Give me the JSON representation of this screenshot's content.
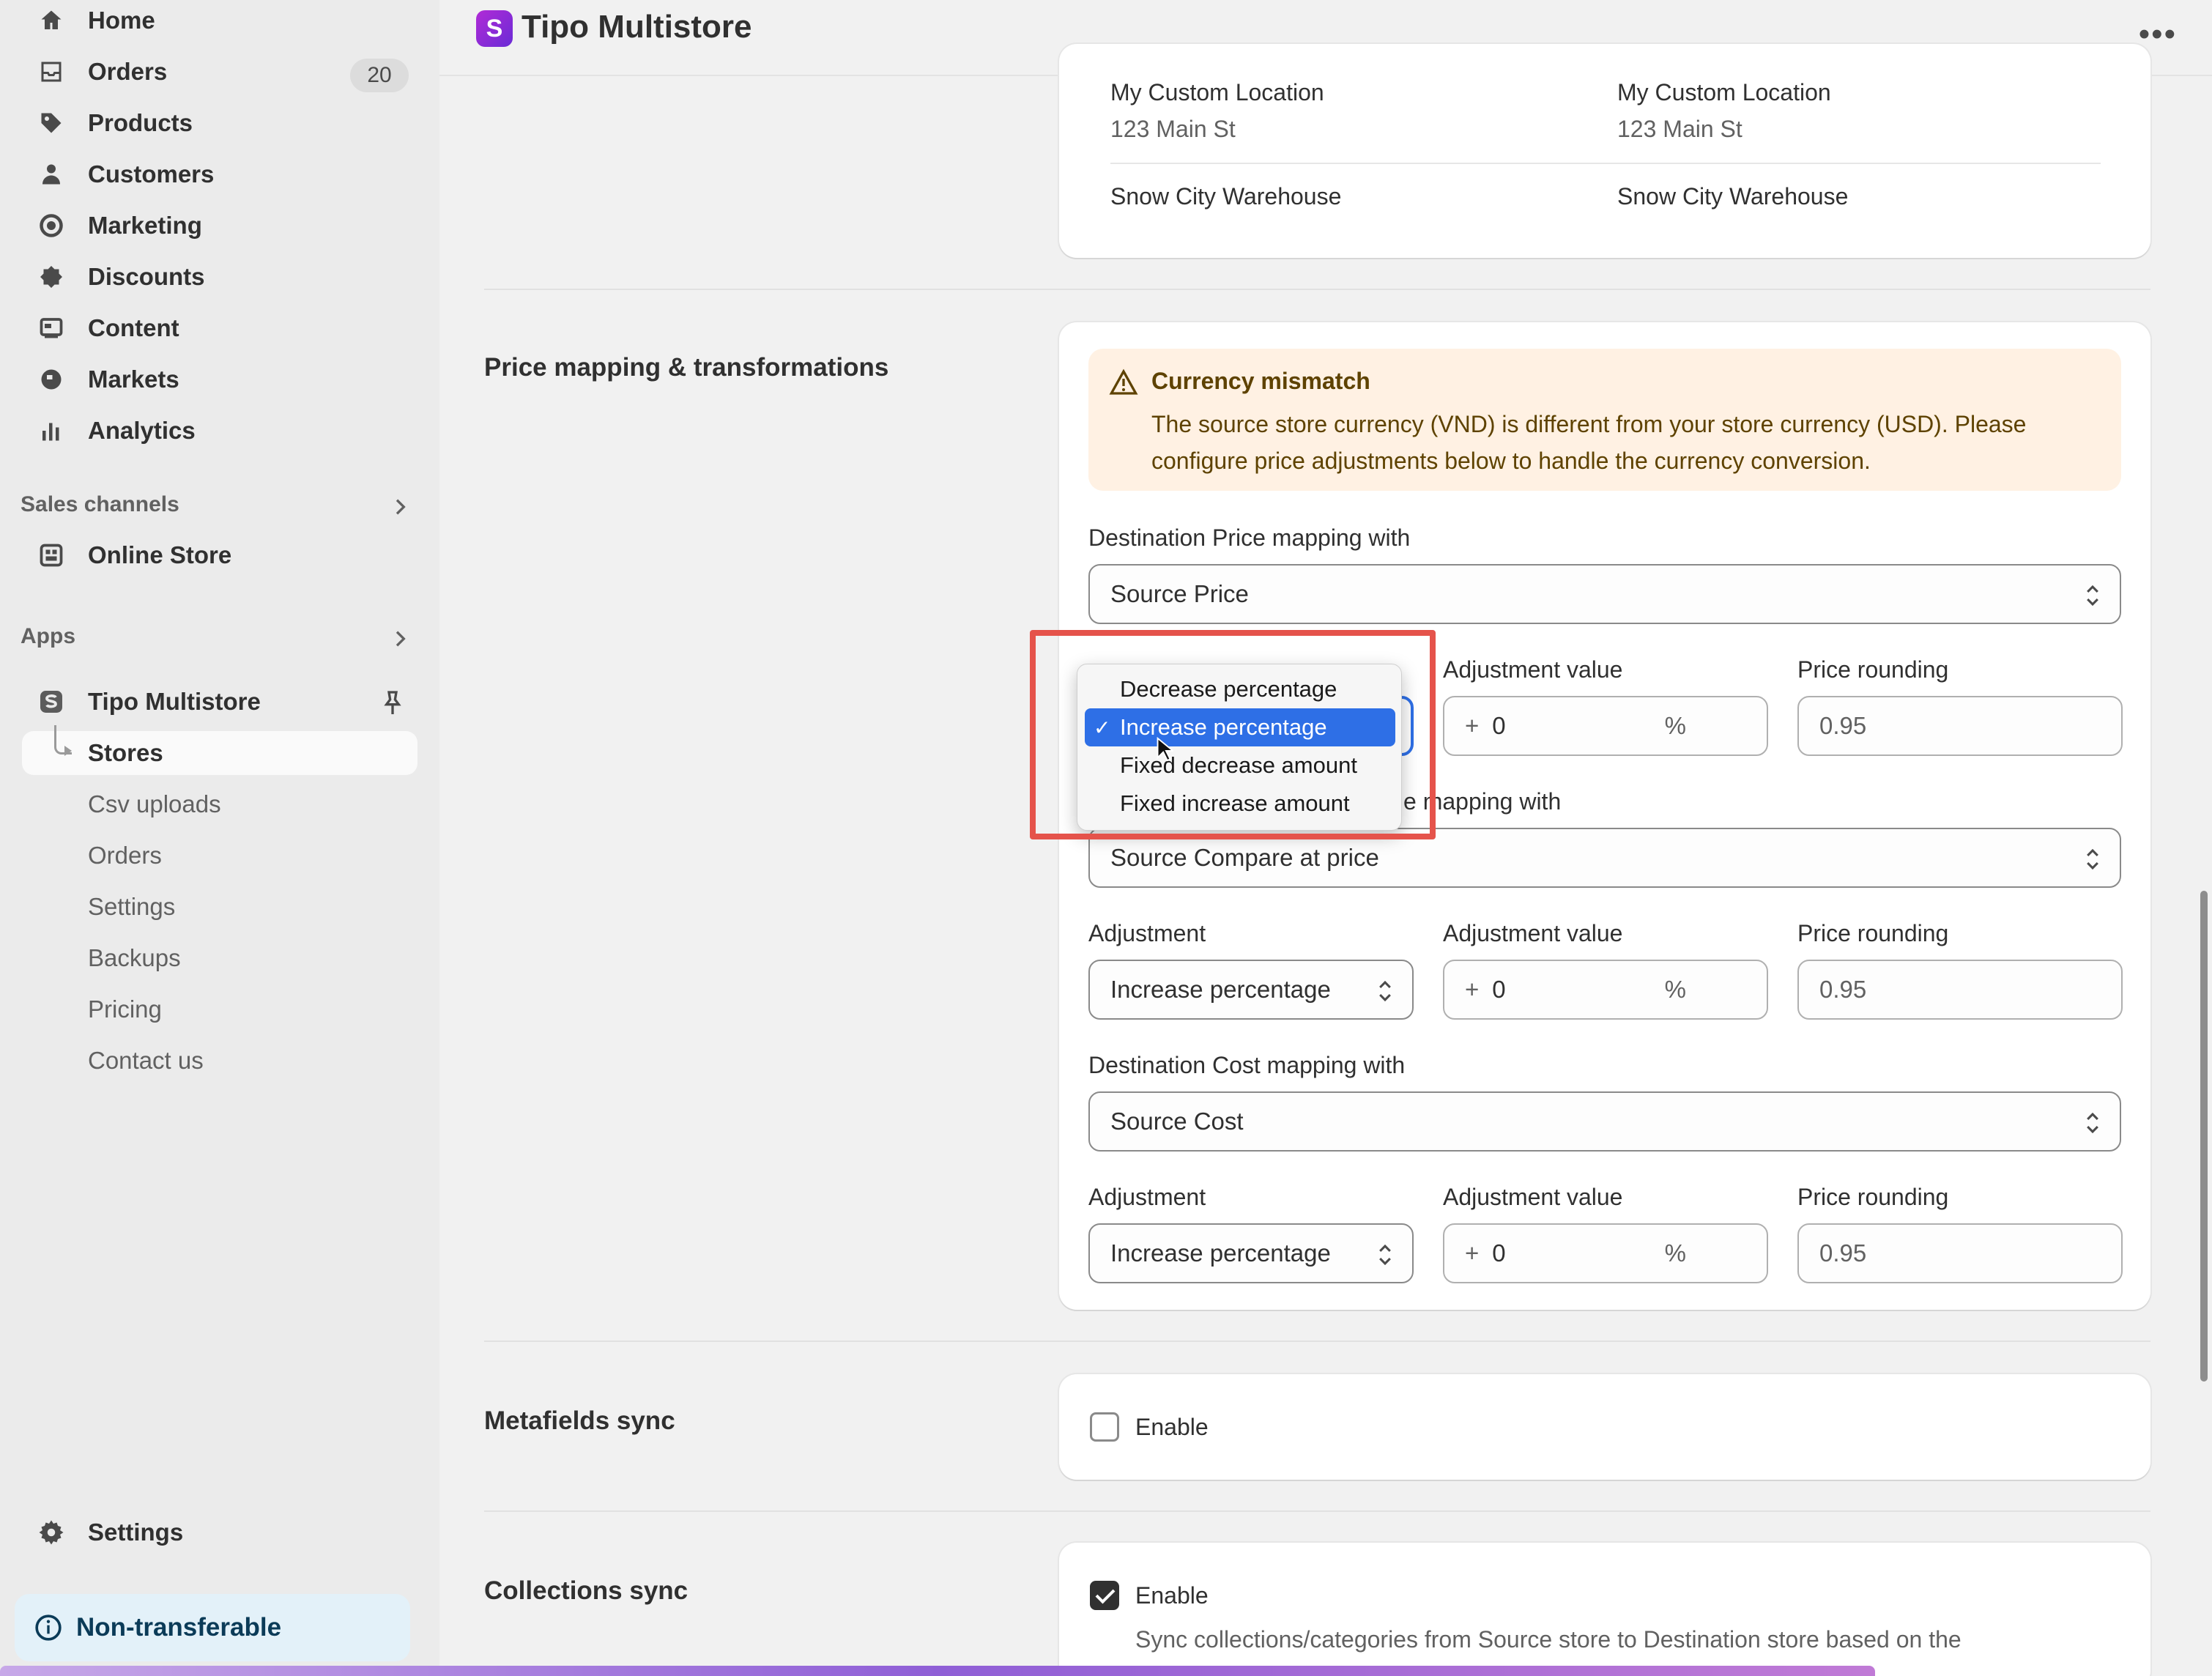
{
  "app": {
    "title": "Tipo Multistore",
    "logo_letter": "S",
    "more_icon": "•••"
  },
  "sidebar": {
    "main_items": [
      {
        "label": "Home",
        "icon": "home-icon"
      },
      {
        "label": "Orders",
        "icon": "orders-icon",
        "badge": "20"
      },
      {
        "label": "Products",
        "icon": "tag-icon"
      },
      {
        "label": "Customers",
        "icon": "person-icon"
      },
      {
        "label": "Marketing",
        "icon": "target-icon"
      },
      {
        "label": "Discounts",
        "icon": "discount-icon"
      },
      {
        "label": "Content",
        "icon": "content-icon"
      },
      {
        "label": "Markets",
        "icon": "globe-icon"
      },
      {
        "label": "Analytics",
        "icon": "bar-chart-icon"
      }
    ],
    "sales_channels_header": "Sales channels",
    "online_store": "Online Store",
    "apps_header": "Apps",
    "app_name": "Tipo Multistore",
    "app_sub_items": [
      "Stores",
      "Csv uploads",
      "Orders",
      "Settings",
      "Backups",
      "Pricing",
      "Contact us"
    ],
    "settings": "Settings",
    "non_transferable": "Non-transferable"
  },
  "locations": {
    "row1_left_name": "My Custom Location",
    "row1_left_addr": "123 Main St",
    "row1_right_name": "My Custom Location",
    "row1_right_addr": "123 Main St",
    "row2_left_name": "Snow City Warehouse",
    "row2_right_name": "Snow City Warehouse"
  },
  "price_mapping": {
    "section_title": "Price mapping & transformations",
    "banner_title": "Currency mismatch",
    "banner_body": "The source store currency (VND) is different from your store currency (USD). Please configure price adjustments below to handle the currency conversion.",
    "price_label": "Destination Price mapping with",
    "price_value": "Source Price",
    "compare_label": "Destination Compare at price mapping with",
    "compare_label_visible": "e mapping with",
    "compare_value": "Source Compare at price",
    "cost_label": "Destination Cost mapping with",
    "cost_value": "Source Cost",
    "adjustment_label": "Adjustment",
    "adjustment_value_label": "Adjustment value",
    "price_rounding_label": "Price rounding",
    "adjustment_selected": "Increase percentage",
    "value_prefix": "+",
    "value": "0",
    "value_suffix": "%",
    "rounding": "0.95",
    "dropdown_options": [
      "Decrease percentage",
      "Increase percentage",
      "Fixed decrease amount",
      "Fixed increase amount"
    ]
  },
  "metafields": {
    "section_title": "Metafields sync",
    "enable_label": "Enable"
  },
  "collections": {
    "section_title": "Collections sync",
    "enable_label": "Enable",
    "description": "Sync collections/categories from Source store to Destination store based on the"
  }
}
